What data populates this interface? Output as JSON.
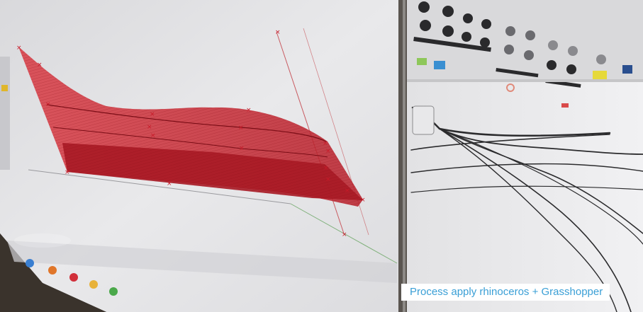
{
  "caption": {
    "text": "Process apply rhinoceros + Grasshopper"
  },
  "colors": {
    "surface_red": "#c8242e",
    "viewport_bg": "#e6e6e8",
    "caption_text": "#3a9fd6",
    "caption_bg": "#ffffff",
    "wire": "#2b2b2d"
  },
  "scene": {
    "left_screen": "rhinoceros-viewport-with-red-surface",
    "right_screen": "grasshopper-canvas-with-wires"
  }
}
